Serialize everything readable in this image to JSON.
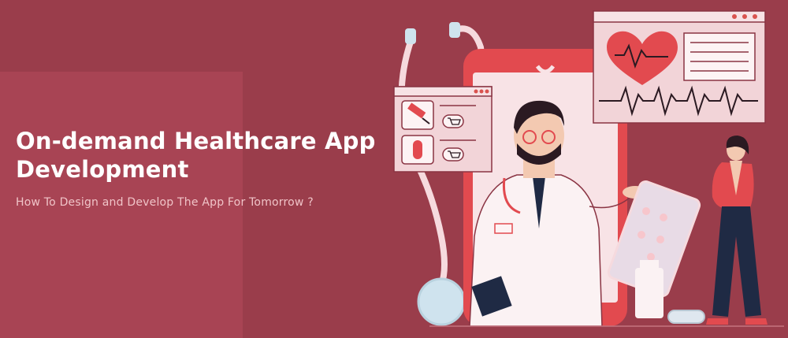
{
  "banner": {
    "title_line1": "On-demand Healthcare App",
    "title_line2": "Development",
    "subtitle": "How To Design and Develop The App For Tomorrow ?"
  },
  "icons": [
    "stethoscope-icon",
    "syringe-icon",
    "pill-icon",
    "cart-icon",
    "heart-icon",
    "pill-bottle-icon"
  ],
  "colors": {
    "background": "#9a3d4b",
    "panel": "#a84454",
    "phone": "#e24a4f",
    "screen": "#f8e3e6",
    "title": "#ffffff",
    "subtitle": "#f0c4c8"
  }
}
